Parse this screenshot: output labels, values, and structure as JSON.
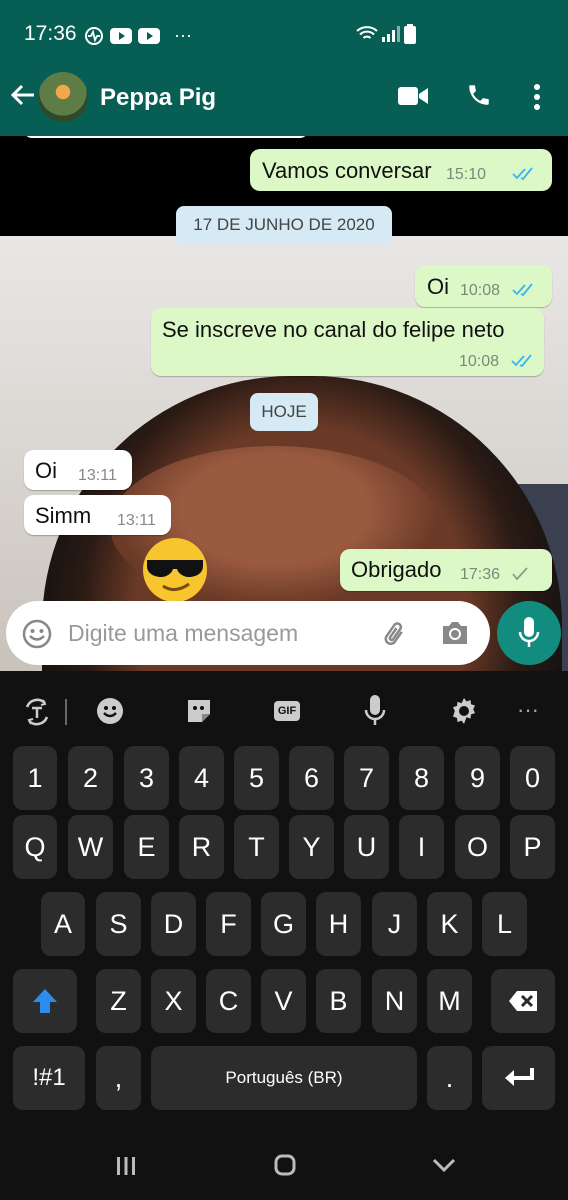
{
  "status_bar": {
    "time": "17:36",
    "more": "···"
  },
  "header": {
    "contact_name": "Peppa Pig"
  },
  "messages": [
    {
      "dir": "out",
      "text": "Vamos conversar",
      "time": "15:10"
    },
    {
      "type": "date",
      "text": "17 DE JUNHO DE 2020"
    },
    {
      "dir": "out",
      "text": "Oi",
      "time": "10:08"
    },
    {
      "dir": "out",
      "text": "Se inscreve no canal do felipe neto",
      "time": "10:08"
    },
    {
      "type": "date",
      "text": "HOJE"
    },
    {
      "dir": "in",
      "text": "Oi",
      "time": "13:11"
    },
    {
      "dir": "in",
      "text": "Simm",
      "time": "13:11"
    },
    {
      "dir": "out",
      "text": "Obrigado",
      "time": "17:36"
    }
  ],
  "input": {
    "placeholder": "Digite uma mensagem"
  },
  "keyboard": {
    "toolbar": {
      "gif": "GIF",
      "more": "···"
    },
    "numbers": [
      "1",
      "2",
      "3",
      "4",
      "5",
      "6",
      "7",
      "8",
      "9",
      "0"
    ],
    "row1": [
      "Q",
      "W",
      "E",
      "R",
      "T",
      "Y",
      "U",
      "I",
      "O",
      "P"
    ],
    "row2": [
      "A",
      "S",
      "D",
      "F",
      "G",
      "H",
      "J",
      "K",
      "L"
    ],
    "row3": [
      "Z",
      "X",
      "C",
      "V",
      "B",
      "N",
      "M"
    ],
    "symbols": "!#1",
    "comma": ",",
    "space": "Português (BR)",
    "period": "."
  },
  "colors": {
    "header": "#075e54",
    "outgoing": "#dcf8c6",
    "read_tick": "#34b7f1",
    "accent": "#128c7e"
  }
}
